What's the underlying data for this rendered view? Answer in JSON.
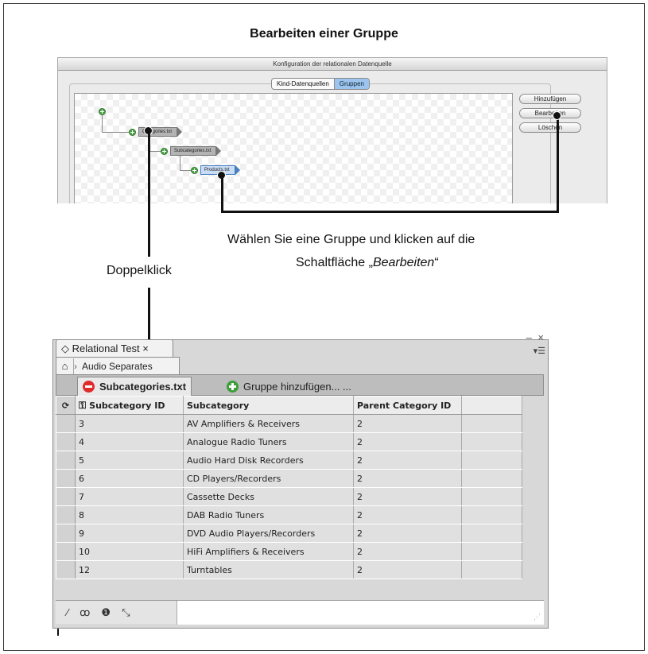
{
  "heading": "Bearbeiten einer Gruppe",
  "dialog": {
    "title": "Konfiguration der relationalen Datenquelle",
    "segments": [
      "Kind-Datenquellen",
      "Gruppen"
    ],
    "active_segment": "Gruppen",
    "buttons": [
      "Hinzufügen",
      "Bearbeiten",
      "Löschen"
    ],
    "tree_nodes": [
      "Categories.txt",
      "Subcategories.txt",
      "Products.txt"
    ],
    "selected_node": "Products.txt"
  },
  "captions": {
    "select_line1": "Wählen Sie eine Gruppe und klicken auf die",
    "select_line2_prefix": "Schaltfläche „",
    "select_line2_button": "Bearbeiten",
    "select_line2_suffix": "“",
    "doubleclick": "Doppelklick"
  },
  "panel": {
    "tab_label": "Relational Test",
    "tab_close": "×",
    "window_controls": "– ×",
    "breadcrumb": "Audio Separates",
    "group_tab": "Subcategories.txt",
    "add_group": "Gruppe hinzufügen... ...",
    "columns": [
      "Subcategory ID",
      "Subcategory",
      "Parent Category ID",
      ""
    ],
    "rows": [
      [
        "3",
        "AV Amplifiers & Receivers",
        "2"
      ],
      [
        "4",
        "Analogue Radio Tuners",
        "2"
      ],
      [
        "5",
        "Audio Hard Disk Recorders",
        "2"
      ],
      [
        "6",
        "CD Players/Recorders",
        "2"
      ],
      [
        "7",
        "Cassette Decks",
        "2"
      ],
      [
        "8",
        "DAB Radio Tuners",
        "2"
      ],
      [
        "9",
        "DVD Audio Players/Recorders",
        "2"
      ],
      [
        "10",
        "HiFi Amplifiers & Receivers",
        "2"
      ],
      [
        "12",
        "Turntables",
        "2"
      ]
    ],
    "status_icons": [
      "wand-icon",
      "binoculars-icon",
      "info-icon",
      "collapse-icon"
    ]
  }
}
